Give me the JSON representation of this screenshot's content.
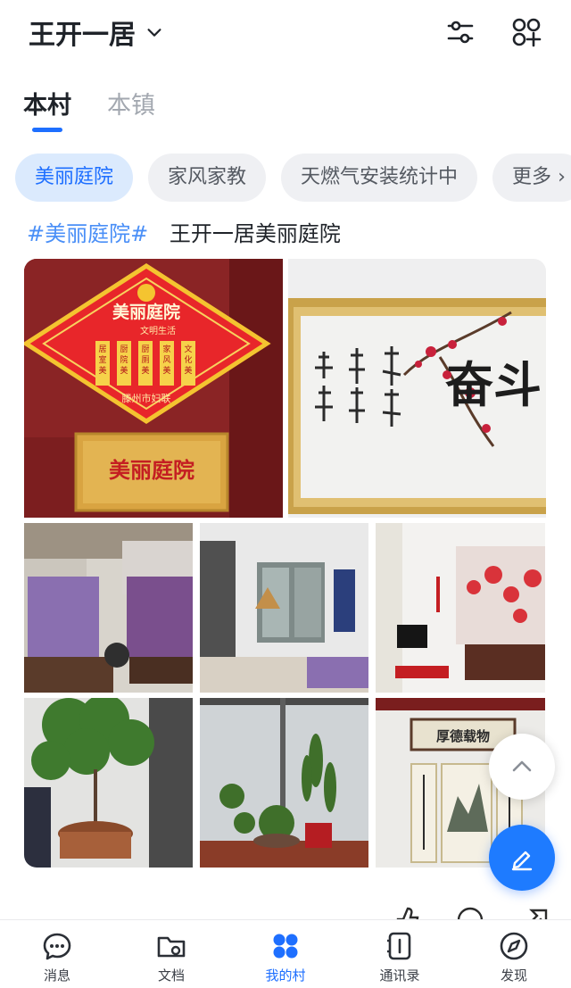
{
  "header": {
    "title": "王开一居"
  },
  "scope_tabs": [
    {
      "label": "本村",
      "active": true
    },
    {
      "label": "本镇",
      "active": false
    }
  ],
  "topics": [
    {
      "label": "美丽庭院",
      "active": true
    },
    {
      "label": "家风家教",
      "active": false
    },
    {
      "label": "天燃气安装统计中",
      "active": false
    },
    {
      "label": "更多",
      "active": false
    }
  ],
  "post": {
    "hashtag": "#美丽庭院#",
    "title": "王开一居美丽庭院",
    "photos": [
      {
        "subject": "courtyard plaque",
        "sign_title": "美丽庭院",
        "sign_subtitle": "文明生活",
        "sign_items": [
          "居室美",
          "厨院美",
          "厨厕美",
          "家风美",
          "文化美"
        ],
        "sign_org": "滕州市妇联",
        "plaque_text": "美丽庭院"
      },
      {
        "subject": "framed calligraphy with plum blossom",
        "calligraphy": "奋斗"
      },
      {
        "subject": "living room sofa"
      },
      {
        "subject": "living room with window"
      },
      {
        "subject": "living room with tv and painting"
      },
      {
        "subject": "potted tree"
      },
      {
        "subject": "window plants"
      },
      {
        "subject": "calligraphy scrolls",
        "plaque_text": "厚德载物"
      }
    ]
  },
  "bottom_nav": [
    {
      "label": "消息",
      "icon": "chat-icon",
      "active": false
    },
    {
      "label": "文档",
      "icon": "folder-icon",
      "active": false
    },
    {
      "label": "我的村",
      "icon": "grid-icon",
      "active": true
    },
    {
      "label": "通讯录",
      "icon": "contacts-icon",
      "active": false
    },
    {
      "label": "发现",
      "icon": "compass-icon",
      "active": false
    }
  ],
  "colors": {
    "accent": "#1e6fff",
    "chip_active_bg": "#dbeafd",
    "chip_bg": "#eff0f3",
    "hashtag": "#4a8ff7"
  }
}
